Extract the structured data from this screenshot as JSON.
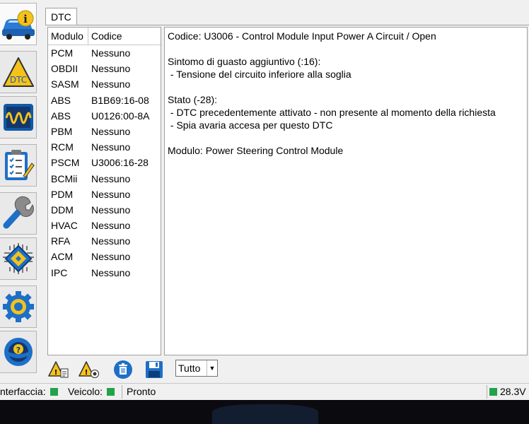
{
  "tab": {
    "label": "DTC"
  },
  "list": {
    "col_module": "Modulo",
    "col_code": "Codice",
    "rows": [
      {
        "module": "PCM",
        "code": "Nessuno"
      },
      {
        "module": "OBDII",
        "code": "Nessuno"
      },
      {
        "module": "SASM",
        "code": "Nessuno"
      },
      {
        "module": "ABS",
        "code": "B1B69:16-08"
      },
      {
        "module": "ABS",
        "code": "U0126:00-8A"
      },
      {
        "module": "PBM",
        "code": "Nessuno"
      },
      {
        "module": "RCM",
        "code": "Nessuno"
      },
      {
        "module": "PSCM",
        "code": "U3006:16-28"
      },
      {
        "module": "BCMii",
        "code": "Nessuno"
      },
      {
        "module": "PDM",
        "code": "Nessuno"
      },
      {
        "module": "DDM",
        "code": "Nessuno"
      },
      {
        "module": "HVAC",
        "code": "Nessuno"
      },
      {
        "module": "RFA",
        "code": "Nessuno"
      },
      {
        "module": "ACM",
        "code": "Nessuno"
      },
      {
        "module": "IPC",
        "code": "Nessuno"
      }
    ]
  },
  "detail": {
    "code_line": "Codice: U3006 - Control Module Input Power A Circuit / Open",
    "symptom_title": "Sintomo di guasto aggiuntivo (:16):",
    "symptom_item": " - Tensione del circuito inferiore alla soglia",
    "status_title": "Stato (-28):",
    "status_item1": " - DTC precedentemente attivato - non presente al momento della richiesta",
    "status_item2": " - Spia avaria accesa per questo DTC",
    "module_line": "Modulo: Power Steering Control Module"
  },
  "filter": {
    "value": "Tutto"
  },
  "status": {
    "interface_label": "nterfaccia:",
    "vehicle_label": "Veicolo:",
    "state": "Pronto",
    "voltage": "28.3V"
  },
  "sidebar": {
    "icons": [
      "vehicle-info-icon",
      "dtc-icon",
      "oscilloscope-icon",
      "checklist-icon",
      "wrench-icon",
      "chip-icon",
      "settings-gear-icon",
      "help-steering-icon"
    ]
  },
  "toolbar": {
    "icons": [
      "read-dtc-icon",
      "dtc-record-icon",
      "clear-dtc-icon",
      "save-icon"
    ]
  },
  "colors": {
    "led_ok": "#22a34a",
    "accent_blue": "#1d6fc7",
    "warning_yellow": "#f4c21a"
  }
}
